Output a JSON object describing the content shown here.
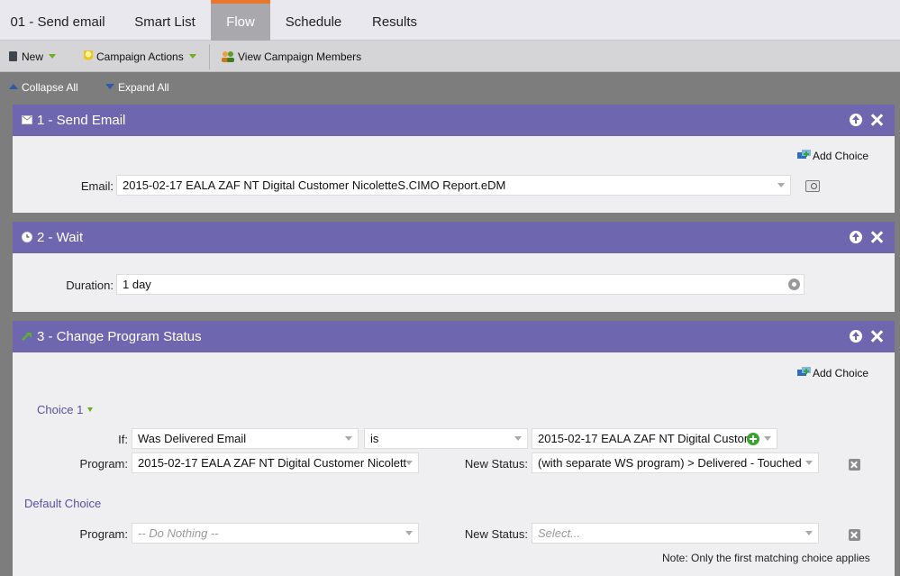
{
  "tabs": [
    {
      "label": "01 - Send email",
      "active": false
    },
    {
      "label": "Smart List",
      "active": false
    },
    {
      "label": "Flow",
      "active": true
    },
    {
      "label": "Schedule",
      "active": false
    },
    {
      "label": "Results",
      "active": false
    }
  ],
  "toolbar": {
    "new_label": "New",
    "campaign_actions_label": "Campaign Actions",
    "view_members_label": "View Campaign Members"
  },
  "collapse_all": "Collapse All",
  "expand_all": "Expand All",
  "colors": {
    "header": "#6e67b0",
    "active_tab_accent": "#e8762c",
    "choice_text": "#5750a8",
    "add_green": "#3aa52e"
  },
  "steps": {
    "send_email": {
      "title": "1 - Send Email",
      "add_choice": "Add Choice",
      "email_label": "Email:",
      "email_value": "2015-02-17 EALA ZAF NT Digital Customer NicoletteS.CIMO Report.eDM"
    },
    "wait": {
      "title": "2 - Wait",
      "duration_label": "Duration:",
      "duration_value": "1 day"
    },
    "change_status": {
      "title": "3 - Change Program Status",
      "add_choice": "Add Choice",
      "choice1_label": "Choice 1",
      "if_label": "If:",
      "if_field": "Was Delivered Email",
      "if_operator": "is",
      "if_value": "2015-02-17 EALA ZAF NT Digital Custom",
      "program_label": "Program:",
      "program_value": "2015-02-17 EALA ZAF NT Digital Customer Nicolett",
      "new_status_label": "New Status:",
      "new_status_value": "(with separate WS program) > Delivered - Touched",
      "default_choice_label": "Default Choice",
      "default_program_label": "Program:",
      "default_program_placeholder": "-- Do Nothing --",
      "default_status_label": "New Status:",
      "default_status_placeholder": "Select...",
      "note": "Note: Only the first matching choice applies"
    }
  }
}
